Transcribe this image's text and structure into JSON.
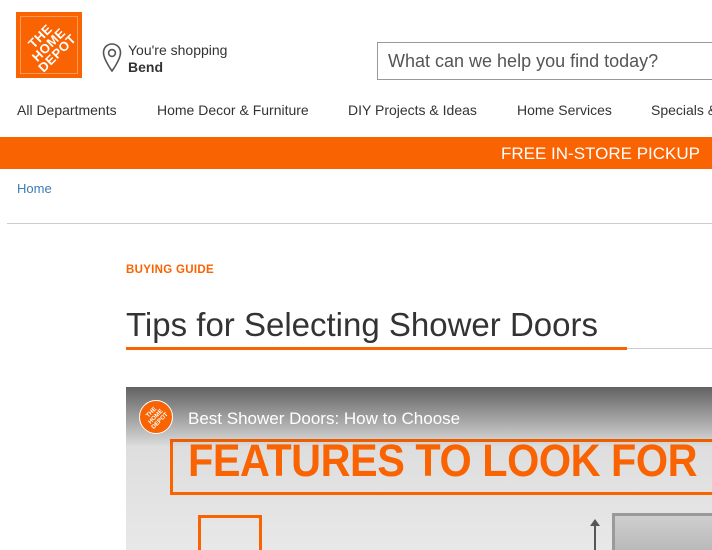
{
  "brand": {
    "logo_text_lines": [
      "THE",
      "HOME",
      "DEPOT"
    ],
    "color": "#f96302"
  },
  "store": {
    "label": "You're shopping",
    "name": "Bend",
    "icon": "location-pin-icon"
  },
  "search": {
    "placeholder": "What can we help you find today?",
    "value": ""
  },
  "nav": {
    "items": [
      "All Departments",
      "Home Decor & Furniture",
      "DIY Projects & Ideas",
      "Home Services",
      "Specials &"
    ]
  },
  "banner": {
    "text": "FREE IN-STORE PICKUP"
  },
  "breadcrumb": {
    "home": "Home"
  },
  "article": {
    "eyebrow": "BUYING GUIDE",
    "title": "Tips for Selecting Shower Doors"
  },
  "video": {
    "title": "Best Shower Doors: How to Choose",
    "overlay_text": "FEATURES TO LOOK FOR",
    "channel_logo_lines": [
      "THE",
      "HOME",
      "DEPOT"
    ]
  },
  "colors": {
    "accent": "#f96302",
    "link": "#3e7bb4",
    "text": "#333333",
    "divider": "#cccccc"
  }
}
